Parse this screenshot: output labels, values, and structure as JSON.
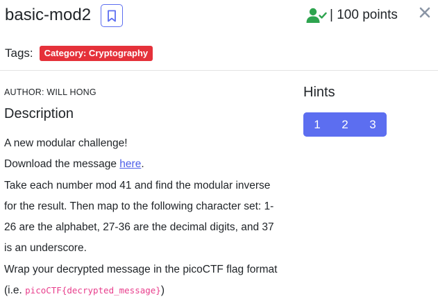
{
  "challenge": {
    "title": "basic-mod2",
    "points_label": "| 100 points"
  },
  "tags": {
    "label": "Tags:",
    "items": [
      "Category: Cryptography"
    ]
  },
  "author": "AUTHOR: WILL HONG",
  "description": {
    "heading": "Description",
    "line1": "A new modular challenge!",
    "line2_prefix": "Download the message ",
    "line2_link": "here",
    "line2_suffix": ".",
    "line3": "Take each number mod 41 and find the modular inverse for the result. Then map to the following character set: 1-26 are the alphabet, 27-36 are the decimal digits, and 37 is an underscore.",
    "line4_prefix": "Wrap your decrypted message in the picoCTF flag format (i.e. ",
    "line4_code": "picoCTF{decrypted_message}",
    "line4_suffix": ")"
  },
  "hints": {
    "heading": "Hints",
    "buttons": [
      "1",
      "2",
      "3"
    ]
  },
  "icons": {
    "bookmark": "bookmark-icon",
    "solved_user": "user-check-icon",
    "close": "close-icon"
  },
  "colors": {
    "accent": "#5c6ef0",
    "tag_red": "#e5313a",
    "solved_green": "#2ea44f",
    "link": "#4b5de8",
    "code_pink": "#e83e8c",
    "close_grey": "#8a95a5"
  }
}
